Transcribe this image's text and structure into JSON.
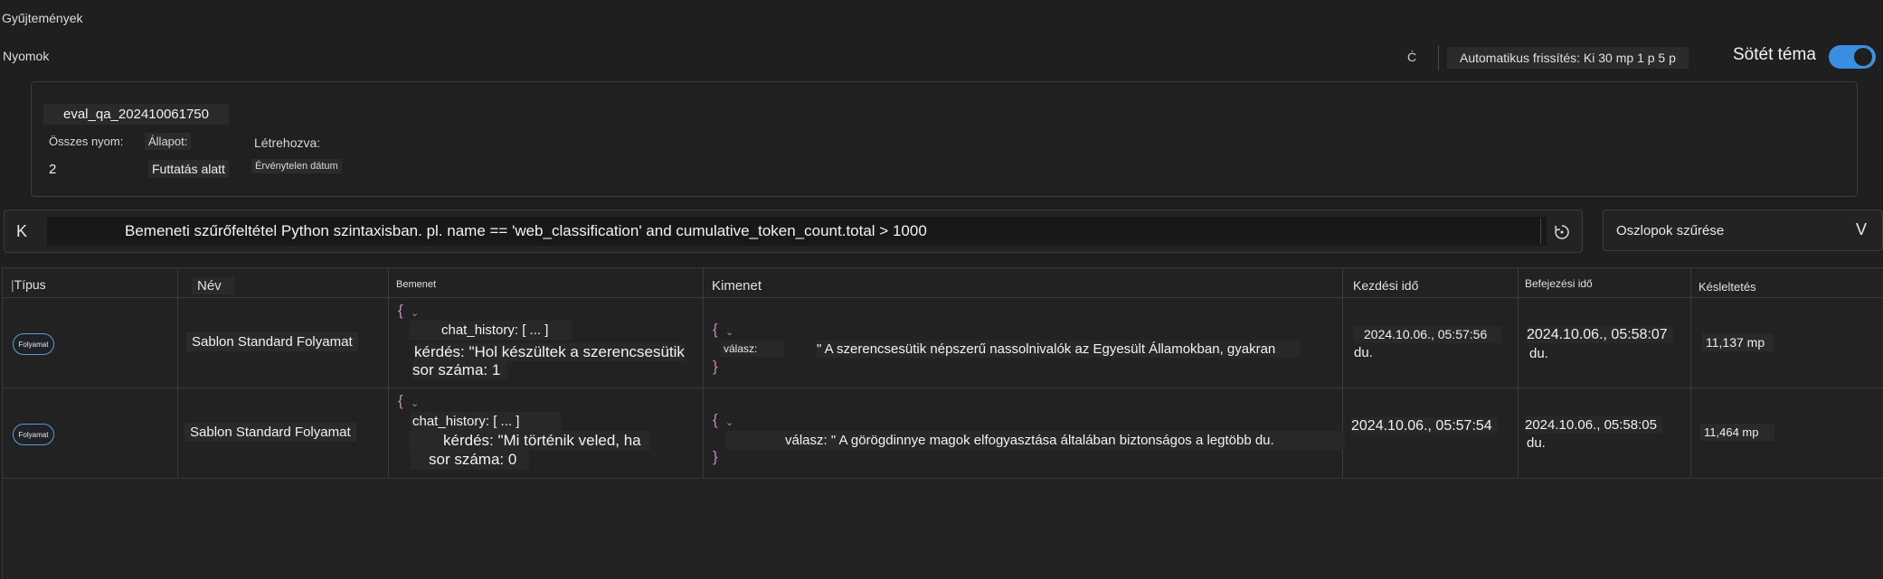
{
  "breadcrumb": {
    "collections": "Gyűjtemények",
    "traces": "Nyomok"
  },
  "toolbar": {
    "refresh_glyph": "Ċ",
    "auto_refresh": "Automatikus frissítés: Ki 30 mp 1 p 5 p",
    "dark_theme_label": "Sötét téma",
    "dark_theme_on": true
  },
  "run": {
    "name": "eval_qa_202410061750",
    "total_traces_label": "Összes nyom:",
    "total_traces_value": "2",
    "status_label": "Állapot:",
    "status_value": "Futtatás alatt",
    "created_label": "Létrehozva:",
    "created_value": "Érvénytelen dátum"
  },
  "filter": {
    "prefix": "K",
    "placeholder": "Bemeneti szűrőfeltétel Python szintaxisban. pl. name == 'web_classification' and cumulative_token_count.total > 1000",
    "columns_filter_label": "Oszlopok szűrése",
    "columns_filter_chevron": "V"
  },
  "table": {
    "headers": {
      "type": "Típus",
      "name": "Név",
      "input": "Bemenet",
      "output": "Kimenet",
      "start": "Kezdési idő",
      "end": "Befejezési idő",
      "latency": "Késleltetés"
    },
    "rows": [
      {
        "type": "Folyamat",
        "name": "Sablon Standard Folyamat",
        "input_open": "{",
        "input_line1": "chat_history: [ ... ]",
        "input_line2": "kérdés: \"Hol készültek a szerencsesütik",
        "input_line3": "sor száma: 1",
        "output_open": "{",
        "output_key": "válasz:",
        "output_value": "\" A szerencsesütik népszerű nassolnivalók az Egyesült Államokban, gyakran",
        "output_close": "}",
        "start_line1": "2024.10.06., 05:57:56",
        "start_line2": "du.",
        "end_line1": "2024.10.06., 05:58:07",
        "end_line2": "du.",
        "latency": "11,137 mp"
      },
      {
        "type": "Folyamat",
        "name": "Sablon Standard Folyamat",
        "input_open": "{",
        "input_line1": "chat_history: [ ... ]",
        "input_line2": "kérdés: \"Mi történik veled, ha",
        "input_line3": "sor száma: 0",
        "output_open": "{",
        "output_value": "válasz: \" A görögdinnye magok elfogyasztása általában biztonságos a legtöbb du.",
        "output_close": "}",
        "start_line1": "2024.10.06., 05:57:54",
        "end_line1": "2024.10.06., 05:58:05",
        "end_line2": "du.",
        "latency": "11,464 mp"
      }
    ]
  },
  "colors": {
    "accent": "#3b8fe0",
    "brace": "#c586c0",
    "background": "#1f1f1f"
  }
}
